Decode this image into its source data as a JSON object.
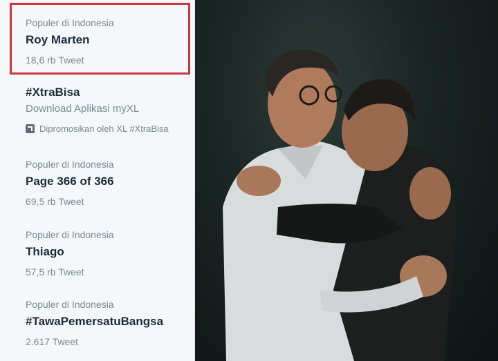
{
  "trends": [
    {
      "context": "Populer di Indonesia",
      "name": "Roy Marten",
      "count": "18,6 rb Tweet"
    },
    {
      "context": "",
      "name": "#XtraBisa",
      "description": "Download Aplikasi myXL",
      "promoted": "Dipromosikan oleh XL #XtraBisa"
    },
    {
      "context": "Populer di Indonesia",
      "name": "Page 366 of 366",
      "count": "69,5 rb Tweet"
    },
    {
      "context": "Populer di Indonesia",
      "name": "Thiago",
      "count": "57,5 rb Tweet"
    },
    {
      "context": "Populer di Indonesia",
      "name": "#TawaPemersatuBangsa",
      "count": "2.617 Tweet"
    }
  ],
  "colors": {
    "highlight": "#c9363f",
    "text": "#1d2a35",
    "muted": "#7b8791"
  },
  "icons": {
    "promoted": "promoted-icon"
  }
}
